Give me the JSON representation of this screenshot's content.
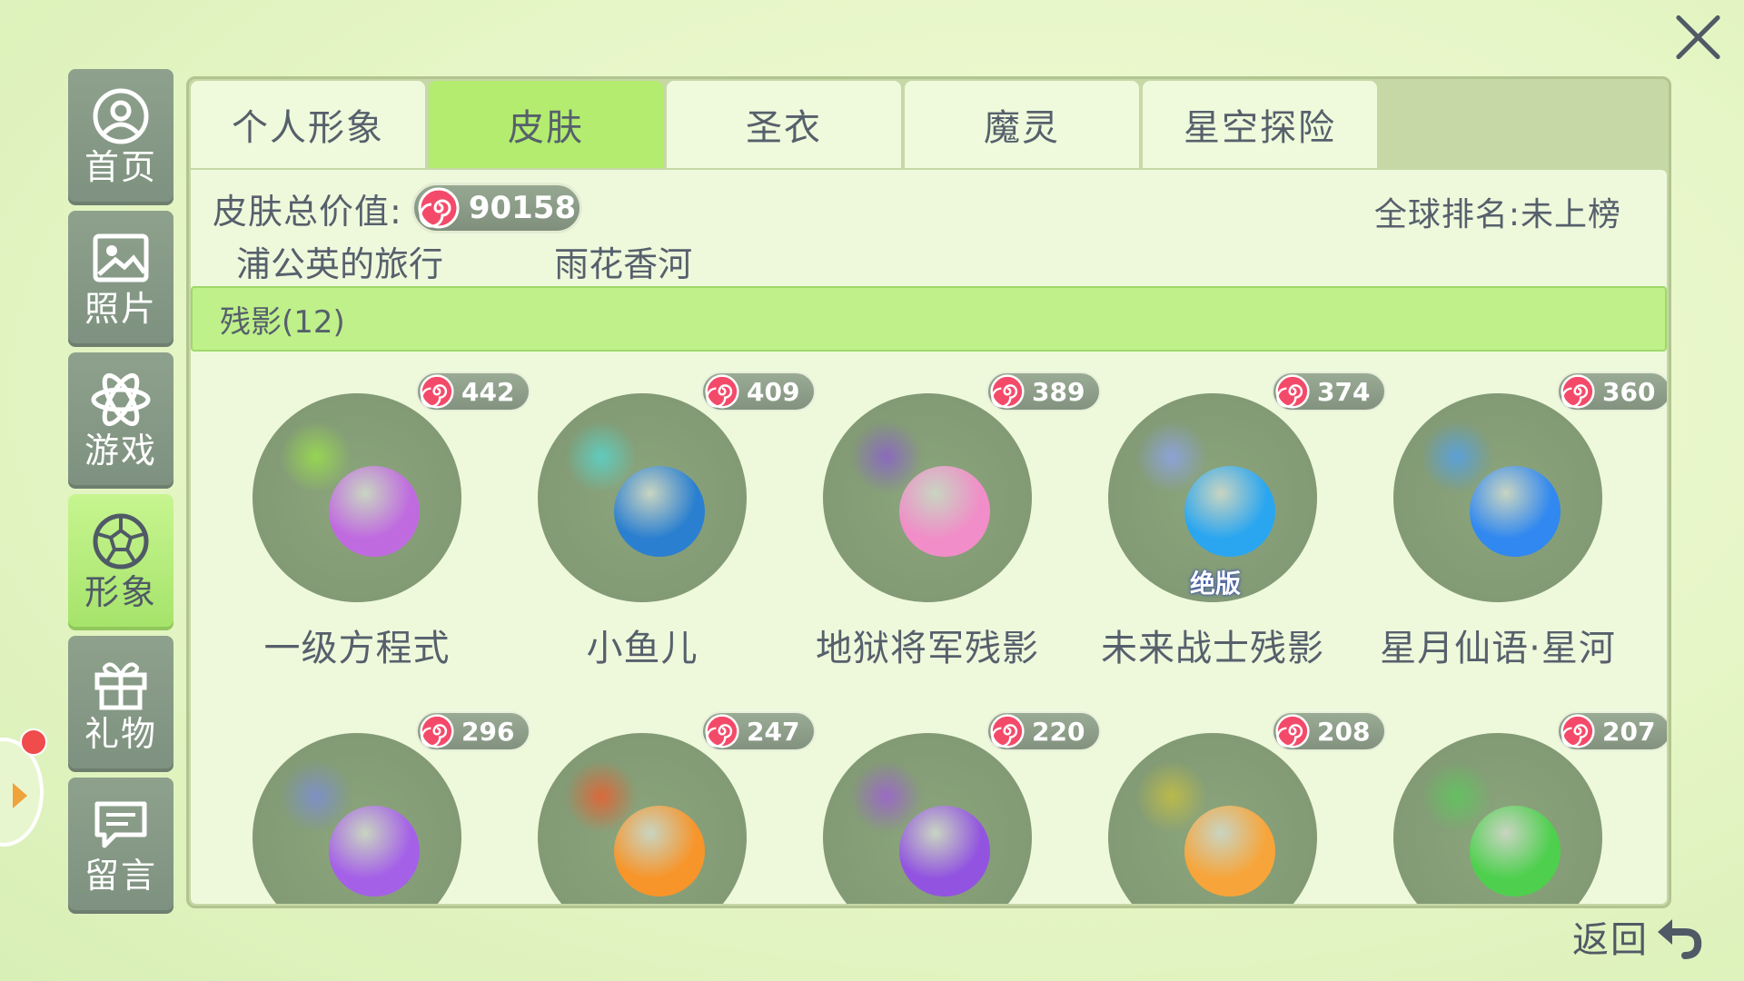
{
  "sidebar": {
    "items": [
      {
        "label": "首页",
        "icon": "person-circle-icon"
      },
      {
        "label": "照片",
        "icon": "photo-icon"
      },
      {
        "label": "游戏",
        "icon": "atom-icon"
      },
      {
        "label": "形象",
        "icon": "soccer-ball-icon",
        "active": true
      },
      {
        "label": "礼物",
        "icon": "gift-icon"
      },
      {
        "label": "留言",
        "icon": "message-icon"
      }
    ]
  },
  "tabs": [
    {
      "label": "个人形象"
    },
    {
      "label": "皮肤",
      "active": true
    },
    {
      "label": "圣衣"
    },
    {
      "label": "魔灵"
    },
    {
      "label": "星空探险"
    }
  ],
  "summary": {
    "total_label": "皮肤总价值:",
    "total_value": "90158",
    "rank_text": "全球排名:未上榜"
  },
  "clipped_row": [
    "浦公英的旅行",
    "雨花香河"
  ],
  "category": {
    "label": "残影(12)"
  },
  "skins": [
    {
      "name": "一级方程式",
      "price": "442",
      "ball": "#c06ae0",
      "trail": "#9be34a"
    },
    {
      "name": "小鱼儿",
      "price": "409",
      "ball": "#2a7fd0",
      "trail": "#56d7d0"
    },
    {
      "name": "地狱将军残影",
      "price": "389",
      "ball": "#f18dc8",
      "trail": "#8b5cd0"
    },
    {
      "name": "未来战士残影",
      "price": "374",
      "ball": "#2aa6f0",
      "trail": "#8fa3f0",
      "badge": "绝版"
    },
    {
      "name": "星月仙语·星河",
      "price": "360",
      "ball": "#3088f0",
      "trail": "#4fa0f0"
    },
    {
      "name": "",
      "price": "296",
      "ball": "#a560e8",
      "trail": "#7a8cd8"
    },
    {
      "name": "",
      "price": "247",
      "ball": "#f7952a",
      "trail": "#f05a2a"
    },
    {
      "name": "",
      "price": "220",
      "ball": "#9254e0",
      "trail": "#a05cd8"
    },
    {
      "name": "",
      "price": "208",
      "ball": "#f7a53a",
      "trail": "#c8c040"
    },
    {
      "name": "",
      "price": "207",
      "ball": "#4ed04e",
      "trail": "#5cc85c"
    }
  ],
  "back": {
    "label": "返回",
    "icon": "return-arrow-icon"
  },
  "close": {
    "icon": "close-icon"
  },
  "colors": {
    "accent": "#b3ec6f",
    "panel": "#c6d8a6",
    "content": "#eef9dc"
  }
}
